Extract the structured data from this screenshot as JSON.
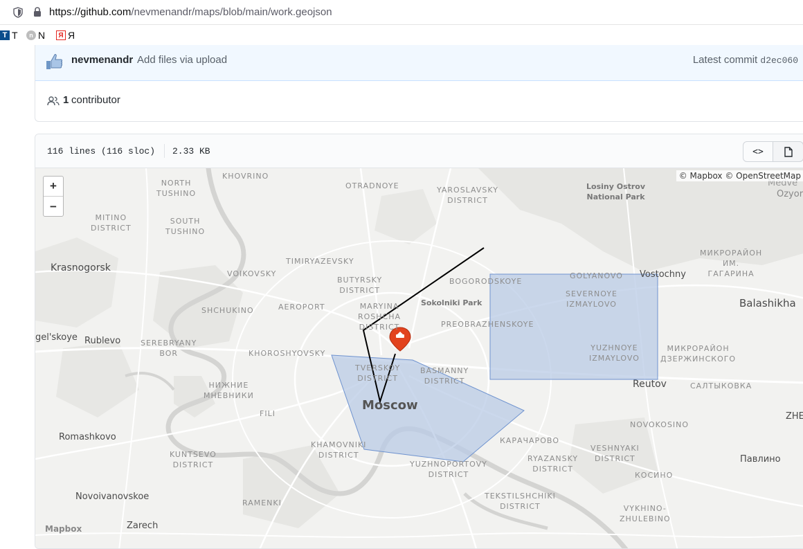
{
  "browser": {
    "url_host": "https://github.com",
    "url_path": "/nevmenandr/maps/blob/main/work.geojson"
  },
  "bookmarks": [
    {
      "label": "T",
      "icon": "T"
    },
    {
      "label": "N",
      "icon": "n"
    },
    {
      "label": "Я",
      "icon": "Я"
    }
  ],
  "commit": {
    "author": "nevmenandr",
    "message": "Add files via upload",
    "latest_label": "Latest commit",
    "sha": "d2ec060"
  },
  "contributors": {
    "count": "1",
    "label": "contributor"
  },
  "file": {
    "lines": "116 lines (116 sloc)",
    "size": "2.33 KB",
    "code_button": "<>"
  },
  "map": {
    "attribution": "© Mapbox © OpenStreetMap",
    "zoom_in": "+",
    "zoom_out": "−",
    "logo": "Mapbox",
    "labels": {
      "khovrino": "KHOVRINO",
      "north_tushino": "NORTH\nTUSHINO",
      "otradnoye": "OTRADNOYE",
      "yaroslavsky": "YAROSLAVSKY\nDISTRICT",
      "losiny": "Losiny Ostrov\nNational Park",
      "medved": "Medve",
      "ozyor": "Ozyor",
      "mitino": "MITINO\nDISTRICT",
      "south_tushino": "SOUTH\nTUSHINO",
      "krasnogorsk": "Krasnogorsk",
      "timiryazevsky": "TIMIRYAZEVSKY",
      "mikroraion_gagarina": "МИКРОРАЙОН\nИМ.\nГАГАРИНА",
      "voikovsky": "VOIKOVSKY",
      "butyrsky": "BUTYRSKY\nDISTRICT",
      "bogorodskoye": "BOGORODSKOYE",
      "golyanovo": "GOLYANOVO",
      "vostochny": "Vostochny",
      "severnoye": "SEVERNOYE\nIZMAYLOVO",
      "balashikha": "Balashikha",
      "shchukino": "SHCHUKINO",
      "aeroport": "AEROPORT",
      "maryina": "MARYINA\nROSHCHA\nDISTRICT",
      "sokolniki": "Sokolniki Park",
      "preobrazhenskoye": "PREOBRAZHENSKOYE",
      "gelskoye": "gel'skoye",
      "rublevo": "Rublevo",
      "serebryany": "SEREBRYANY\nBOR",
      "khoroshyovsky": "KHOROSHYOVSKY",
      "yuzhnoye": "YUZHNOYE\nIZMAYLOVO",
      "dzerzhinskogo": "МИКРОРАЙОН\nДЗЕРЖИНСКОГО",
      "tverskoy": "TVERSKOY\nDISTRICT",
      "basmanny": "BASMANNY\nDISTRICT",
      "reutov": "Reutov",
      "saltykovka": "САЛТЫКОВКА",
      "nizhnie": "НИЖНИЕ\nМНЕВНИКИ",
      "moscow": "Moscow",
      "fili": "FILI",
      "novokosino": "NOVOKOSINO",
      "zhel": "ZHEL",
      "romashkovo": "Romashkovo",
      "khamovniki": "KHAMOVNIKI\nDISTRICT",
      "karacharovo": "КАРАЧАРОВО",
      "veshnyaki": "VESHNYAKI\nDISTRICT",
      "pavlino": "Павлино",
      "kuntsevo": "KUNTSEVO\nDISTRICT",
      "yuzhnoportovy": "YUZHNOPORTOVY\nDISTRICT",
      "ryazansky": "RYAZANSKY\nDISTRICT",
      "kosino": "КОСИНО",
      "novoivanovskoe": "Novoivanovskoe",
      "ramenki": "RAMENKI",
      "tekstilshchiki": "TEKSTILSHCHIKI\nDISTRICT",
      "vykhino": "VYKHINO-\nZHULEBINO",
      "zarech": "Zarech"
    }
  },
  "colors": {
    "polygon_fill": "#b9cbe6",
    "polygon_stroke": "#6f93cf",
    "line": "#000000",
    "marker": "#e2431e"
  }
}
